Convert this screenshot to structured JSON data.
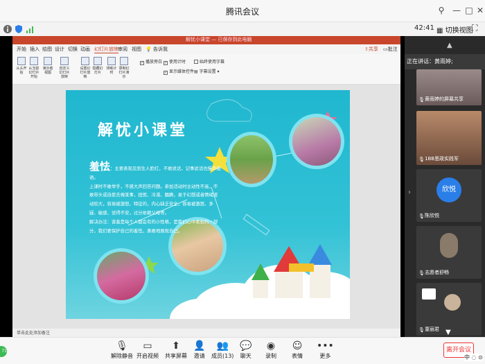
{
  "window": {
    "title": "腾讯会议"
  },
  "statusbar": {
    "timer": "42:41",
    "switch_view": "切换视图"
  },
  "ppt": {
    "file_title": "解忧小课堂 — 已保存到此电脑",
    "tabs": [
      "开始",
      "插入",
      "绘图",
      "设计",
      "切换",
      "动画",
      "幻灯片放映",
      "审阅",
      "视图",
      "告诉我"
    ],
    "active_tab": "幻灯片放映",
    "share_label": "共享",
    "comment_label": "批注",
    "ribbon_buttons": [
      "从头开始",
      "从当前幻灯片开始",
      "演示者视图",
      "自定义幻灯片放映",
      "设置幻灯片放映",
      "隐藏幻灯片",
      "排练计时",
      "录制幻灯片演示"
    ],
    "ribbon_checks": [
      "播放旁白",
      "使用计时",
      "显示媒体控件",
      "始终使用字幕"
    ],
    "subtitle_settings": "字幕设置",
    "status_text": "单击此处添加备注"
  },
  "slide": {
    "title": "解忧小课堂",
    "heading": "羞怯",
    "body": [
      "：主要表现见到生人脸红，不敢说话，记事说话也慢声细语。",
      "上课时不敢举手，不感大声回答问题。参加活动时主动性不高，不敢带头或自愿去做某事，扭怩、冷漠、腼腆，易于幻想或者情绪波动较大，容易被激怒、特征的，内心缺乏安全，容易被激怒、多疑、敏感，觉得不安，过分依赖父母等。",
      "解决办法：害羞是每个人都会有的小性格，是我们心中柔软的一部分，我们要保护自己的羞怯，勇敢地展现自己。"
    ]
  },
  "right_panel": {
    "speaking_label": "正在讲话：黄雨婷;",
    "participants": [
      {
        "name": "黄雨婷的屏幕共享"
      },
      {
        "name": "1BB思政实践军"
      },
      {
        "name": "陈欣悦",
        "avatar_text": "欣悦"
      },
      {
        "name": "志愿者舒畅"
      },
      {
        "name": "童丽君"
      }
    ]
  },
  "toolbar": {
    "buttons": [
      {
        "label": "解除静音",
        "icon": "mic-muted-icon"
      },
      {
        "label": "开启视频",
        "icon": "camera-off-icon"
      },
      {
        "label": "共享屏幕",
        "icon": "share-screen-icon"
      },
      {
        "label": "邀请",
        "icon": "invite-icon"
      },
      {
        "label": "成员(13)",
        "icon": "members-icon"
      },
      {
        "label": "聊天",
        "icon": "chat-icon"
      },
      {
        "label": "录制",
        "icon": "record-icon"
      },
      {
        "label": "表情",
        "icon": "emoji-icon"
      },
      {
        "label": "更多",
        "icon": "more-icon"
      }
    ],
    "leave": "离开会议",
    "ime": "中 ◌ ⊙",
    "badge": "71"
  },
  "colors": {
    "slide_bg": "#1fb7cf",
    "ppt_accent": "#c8462b",
    "leave_red": "#e33"
  }
}
